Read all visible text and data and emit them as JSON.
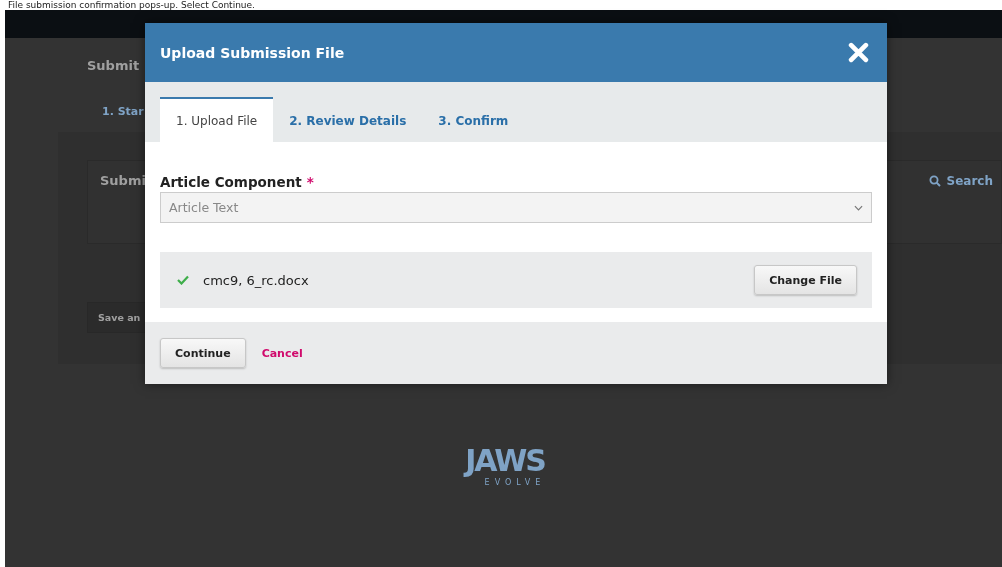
{
  "caption": "File submission confirmation pops-up. Select Continue.",
  "background": {
    "page_title": "Submit",
    "steps": [
      "1. Star"
    ],
    "panel_title": "Submi",
    "search": "Search",
    "save_button": "Save an",
    "logo": {
      "wordmark": "JAWS",
      "tagline": "EVOLVE"
    }
  },
  "dialog": {
    "title": "Upload Submission File",
    "tabs": [
      {
        "label": "1. Upload File",
        "selected": true
      },
      {
        "label": "2. Review Details",
        "selected": false
      },
      {
        "label": "3. Confirm",
        "selected": false
      }
    ],
    "field": {
      "label": "Article Component",
      "required_mark": "*",
      "value": "Article Text"
    },
    "file": {
      "name": "cmc9, 6_rc.docx",
      "uploaded": true
    },
    "change_button": "Change File",
    "continue_button": "Continue",
    "cancel_link": "Cancel"
  }
}
